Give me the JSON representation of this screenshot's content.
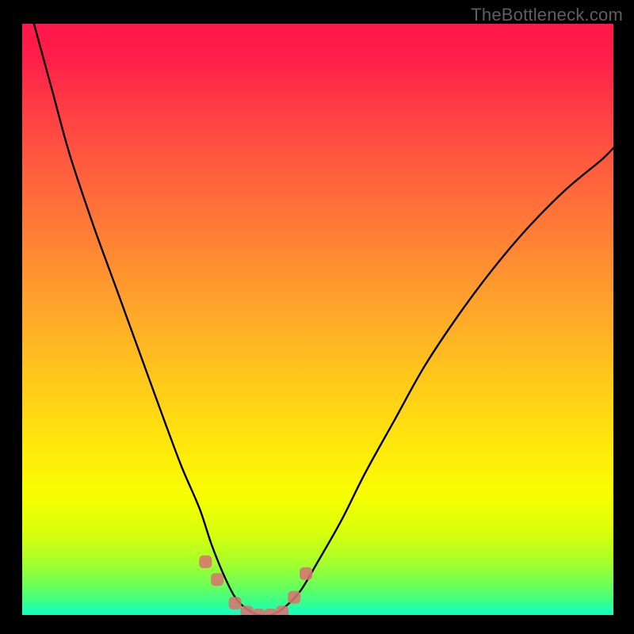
{
  "watermark": "TheBottleneck.com",
  "colors": {
    "background": "#000000",
    "watermark_text": "#5f5f5f",
    "curve_stroke": "#000000",
    "marker_fill": "#d8746f",
    "gradient_stops": [
      "#ff1749",
      "#ff1f49",
      "#ff3b45",
      "#ff5c3e",
      "#ff8035",
      "#ffa52a",
      "#ffc81b",
      "#ffe90b",
      "#f7ff02",
      "#d9ff0b",
      "#a7ff2a",
      "#6cff58",
      "#34ff90",
      "#14ffc6"
    ]
  },
  "chart_data": {
    "type": "line",
    "title": "",
    "xlabel": "",
    "ylabel": "",
    "xlim": [
      0,
      100
    ],
    "ylim": [
      0,
      100
    ],
    "grid": false,
    "legend": false,
    "series": [
      {
        "name": "bottleneck-curve",
        "x": [
          2,
          5,
          8,
          12,
          16,
          20,
          24,
          27,
          30,
          32,
          34,
          36,
          38,
          40,
          42,
          44,
          47,
          50,
          54,
          58,
          63,
          68,
          74,
          80,
          86,
          92,
          98,
          100
        ],
        "y": [
          100,
          89,
          78,
          66,
          55,
          44,
          33,
          25,
          18,
          12,
          7,
          3,
          1,
          0,
          0,
          1,
          4,
          9,
          16,
          24,
          33,
          42,
          51,
          59,
          66,
          72,
          77,
          79
        ]
      }
    ],
    "annotations": {
      "valley_markers_x": [
        31,
        33,
        36,
        38,
        40,
        42,
        44,
        46,
        48
      ],
      "valley_markers_y": [
        9,
        6,
        2,
        0.5,
        0,
        0,
        0.5,
        3,
        7
      ]
    }
  }
}
